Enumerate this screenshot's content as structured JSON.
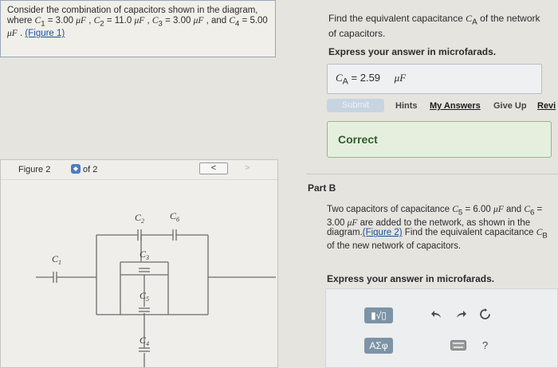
{
  "problem": {
    "text_1": "Consider the combination of capacitors shown in the diagram, where ",
    "c1": "C",
    "c1_sub": "1",
    "c1_val": " = 3.00 ",
    "unit": "μF",
    "c2": "C",
    "c2_sub": "2",
    "c2_val": " = 11.0 ",
    "c3": "C",
    "c3_sub": "3",
    "c3_val": " = 3.00 ",
    "c4": "C",
    "c4_sub": "4",
    "c4_val": " = 5.00 ",
    "and": " , and ",
    "comma": " , ",
    "period": " . ",
    "figure_link": "(Figure 1)"
  },
  "part_a": {
    "question_1": "Find the equivalent capacitance ",
    "ca": "C",
    "ca_sub": "A",
    "question_2": " of the network of capacitors.",
    "express": "Express your answer in microfarads.",
    "answer_label": "C",
    "answer_sub": "A",
    "answer_eq": " = ",
    "answer_value": "2.59",
    "answer_unit": "μF",
    "submit": "Submit",
    "hints": "Hints",
    "my_answers": "My Answers",
    "give_up": "Give Up",
    "review": "Revi",
    "correct": "Correct"
  },
  "figure": {
    "label": "Figure 2",
    "of": "of 2",
    "prev": "<",
    "next": ">",
    "labels": [
      "C",
      "2",
      "C",
      "6",
      "C",
      "1",
      "C",
      "3",
      "C",
      "5",
      "C",
      "4"
    ]
  },
  "part_b": {
    "title": "Part B",
    "text_1": "Two capacitors of capacitance ",
    "c5": "C",
    "c5_sub": "5",
    "c5_val": " = 6.00 ",
    "unit": "μF",
    "and": " and ",
    "c6": "C",
    "c6_sub": "6",
    "c6_val": " = 3.00 ",
    "text_2": " are added to the network, as shown in the diagram.",
    "figure_link": "(Figure 2)",
    "text_3": " Find the equivalent capacitance ",
    "cb": "C",
    "cb_sub": "B",
    "text_4": " of the new network of capacitors.",
    "express": "Express your answer in microfarads.",
    "tool_templates": "▮√▯",
    "tool_greek": "ΑΣφ",
    "help": "?"
  }
}
